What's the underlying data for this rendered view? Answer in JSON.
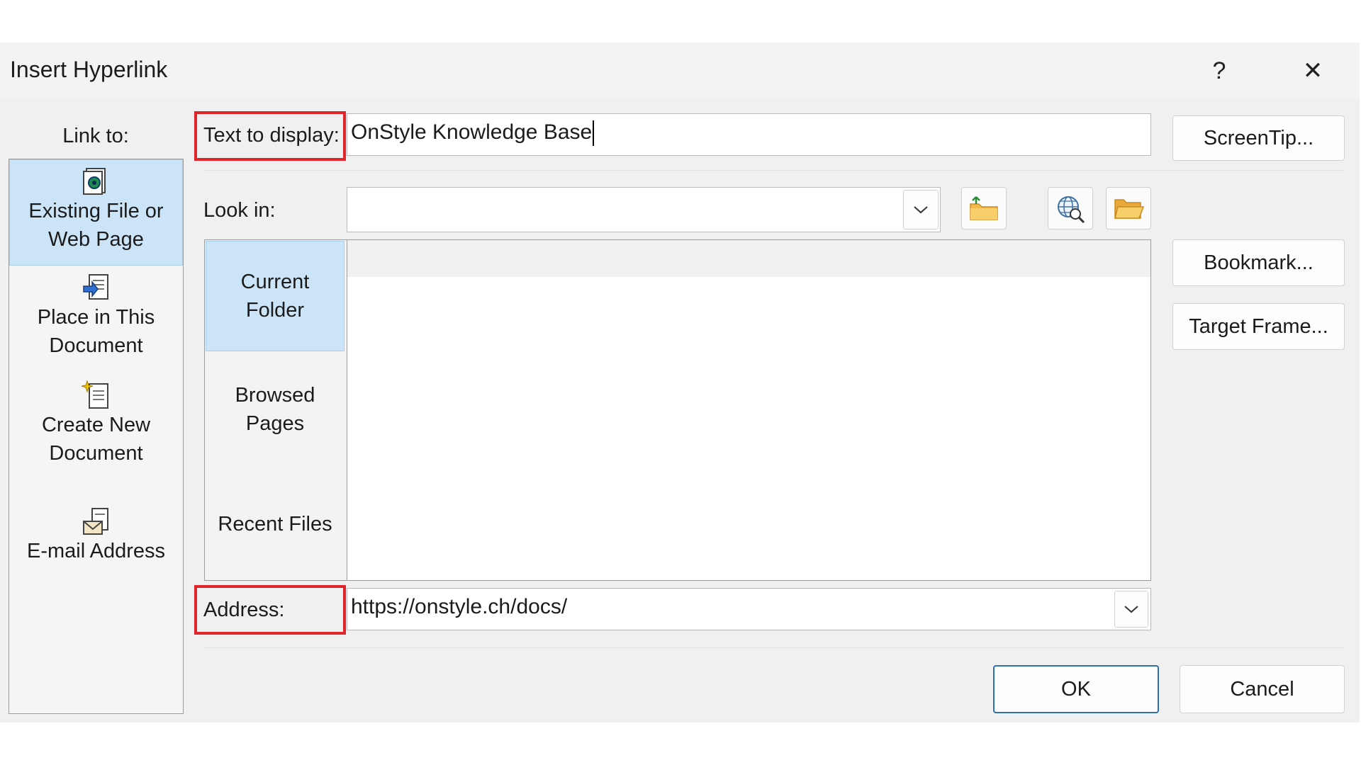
{
  "window": {
    "title": "Insert Hyperlink",
    "help_label": "?",
    "close_label": "✕"
  },
  "link_to": {
    "label": "Link to:",
    "items": [
      {
        "line1": "Existing File or",
        "line2": "Web Page",
        "icon": "existing-file-icon",
        "selected": true
      },
      {
        "line1": "Place in This",
        "line2": "Document",
        "icon": "place-in-document-icon",
        "selected": false
      },
      {
        "line1": "Create New",
        "line2": "Document",
        "icon": "create-new-document-icon",
        "selected": false
      },
      {
        "line1": "E-mail Address",
        "line2": "",
        "icon": "email-address-icon",
        "selected": false
      }
    ]
  },
  "text_to_display": {
    "label": "Text to display:",
    "value": "OnStyle Knowledge Base"
  },
  "screentip_label": "ScreenTip...",
  "look_in": {
    "label": "Look in:",
    "value": ""
  },
  "browser_tabs": [
    {
      "line1": "Current",
      "line2": "Folder",
      "selected": true
    },
    {
      "line1": "Browsed",
      "line2": "Pages",
      "selected": false
    },
    {
      "line1": "Recent Files",
      "line2": "",
      "selected": false
    }
  ],
  "bookmark_label": "Bookmark...",
  "target_frame_label": "Target Frame...",
  "address": {
    "label": "Address:",
    "value": "https://onstyle.ch/docs/"
  },
  "ok_label": "OK",
  "cancel_label": "Cancel",
  "colors": {
    "selection": "#cce4f7",
    "highlight_box": "#e0262b",
    "primary_border": "#2e6fb4"
  }
}
